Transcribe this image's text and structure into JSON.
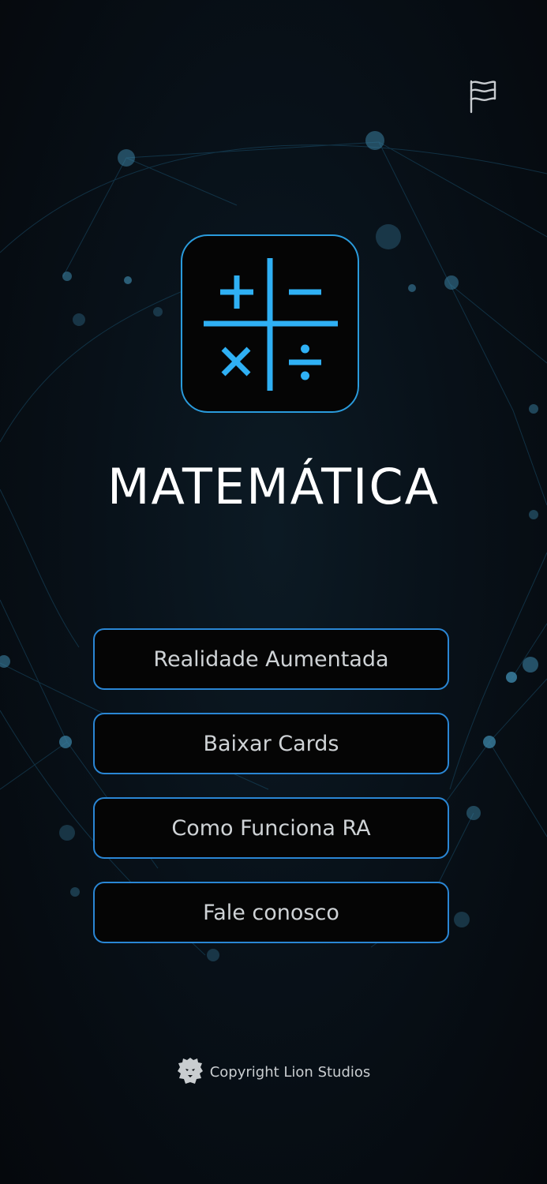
{
  "app": {
    "title": "MATEMÁTICA",
    "logo_icon": "math-operators-icon",
    "accent_color": "#2fb0f4"
  },
  "header": {
    "language_icon": "flag-icon"
  },
  "menu": {
    "items": [
      {
        "label": "Realidade Aumentada"
      },
      {
        "label": "Baixar Cards"
      },
      {
        "label": "Como Funciona RA"
      },
      {
        "label": "Fale conosco"
      }
    ]
  },
  "footer": {
    "logo_icon": "lion-logo-icon",
    "copyright": "Copyright Lion Studios"
  }
}
